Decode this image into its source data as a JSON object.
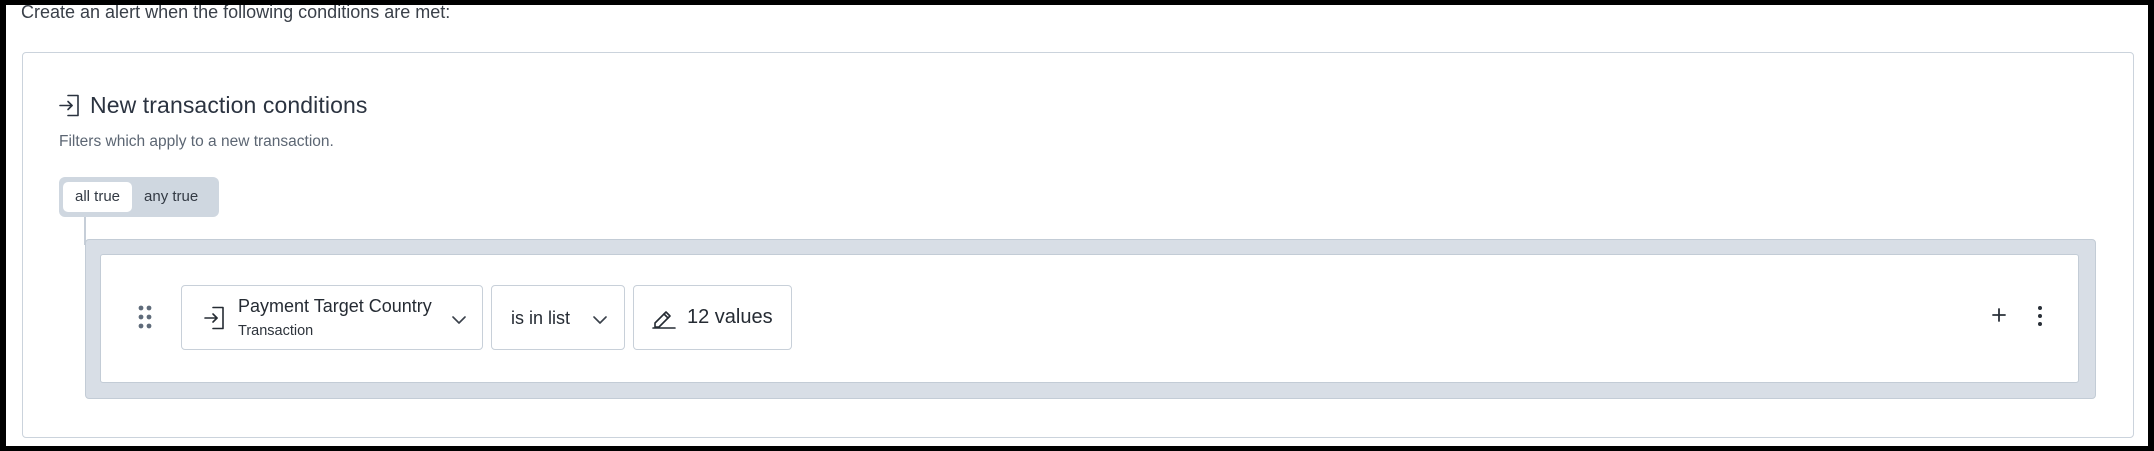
{
  "intro_text": "Create an alert when the following conditions are met:",
  "section": {
    "title": "New transaction conditions",
    "subtitle": "Filters which apply to a new transaction.",
    "icon": "enter-icon"
  },
  "match_toggle": {
    "options": [
      "all true",
      "any true"
    ],
    "selected": "all true"
  },
  "condition": {
    "field": {
      "name": "Payment Target Country",
      "source": "Transaction",
      "icon": "enter-icon"
    },
    "operator": "is in list",
    "values_label": "12 values",
    "values_icon": "pencil-icon"
  },
  "row_actions": {
    "add_icon": "plus-icon",
    "more_icon": "kebab-menu-icon"
  },
  "colors": {
    "group_background": "#d8dee6",
    "border": "#c8d0d9",
    "text_primary": "#252b33",
    "text_muted": "#5c6673"
  }
}
